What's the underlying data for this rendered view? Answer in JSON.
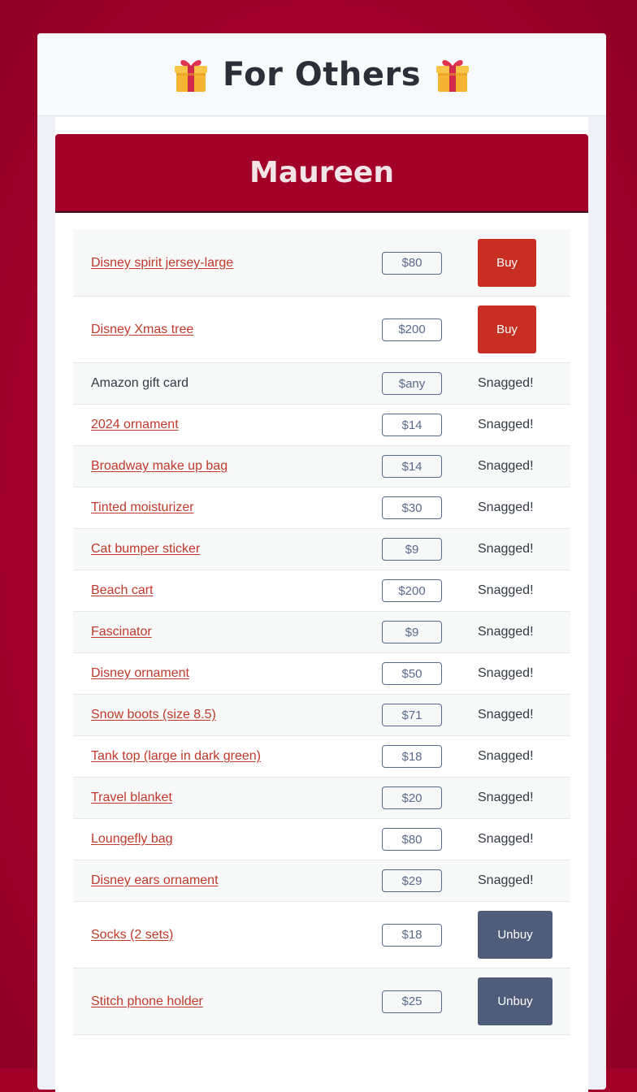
{
  "header": {
    "title": "For Others",
    "icon": "gift-icon"
  },
  "person": {
    "name": "Maureen"
  },
  "items": [
    {
      "name": "Disney spirit jersey-large",
      "linked": true,
      "price": "$80",
      "status": "buy",
      "action_label": "Buy"
    },
    {
      "name": "Disney Xmas tree",
      "linked": true,
      "price": "$200",
      "status": "buy",
      "action_label": "Buy"
    },
    {
      "name": "Amazon gift card",
      "linked": false,
      "price": "$any",
      "status": "snagged",
      "action_label": "Snagged!"
    },
    {
      "name": "2024 ornament",
      "linked": true,
      "price": "$14",
      "status": "snagged",
      "action_label": "Snagged!"
    },
    {
      "name": "Broadway make up bag",
      "linked": true,
      "price": "$14",
      "status": "snagged",
      "action_label": "Snagged!"
    },
    {
      "name": "Tinted moisturizer",
      "linked": true,
      "price": "$30",
      "status": "snagged",
      "action_label": "Snagged!"
    },
    {
      "name": "Cat bumper sticker",
      "linked": true,
      "price": "$9",
      "status": "snagged",
      "action_label": "Snagged!"
    },
    {
      "name": "Beach cart",
      "linked": true,
      "price": "$200",
      "status": "snagged",
      "action_label": "Snagged!"
    },
    {
      "name": "Fascinator",
      "linked": true,
      "price": "$9",
      "status": "snagged",
      "action_label": "Snagged!"
    },
    {
      "name": "Disney ornament",
      "linked": true,
      "price": "$50",
      "status": "snagged",
      "action_label": "Snagged!"
    },
    {
      "name": "Snow boots (size 8.5)",
      "linked": true,
      "price": "$71",
      "status": "snagged",
      "action_label": "Snagged!"
    },
    {
      "name": "Tank top (large in dark green)",
      "linked": true,
      "price": "$18",
      "status": "snagged",
      "action_label": "Snagged!"
    },
    {
      "name": "Travel blanket",
      "linked": true,
      "price": "$20",
      "status": "snagged",
      "action_label": "Snagged!"
    },
    {
      "name": "Loungefly bag",
      "linked": true,
      "price": "$80",
      "status": "snagged",
      "action_label": "Snagged!"
    },
    {
      "name": "Disney ears ornament",
      "linked": true,
      "price": "$29",
      "status": "snagged",
      "action_label": "Snagged!"
    },
    {
      "name": "Socks (2 sets)",
      "linked": true,
      "price": "$18",
      "status": "unbuy",
      "action_label": "Unbuy"
    },
    {
      "name": "Stitch phone holder",
      "linked": true,
      "price": "$25",
      "status": "unbuy",
      "action_label": "Unbuy"
    }
  ],
  "colors": {
    "background": "#a30029",
    "banner": "#a30029",
    "buy_button": "#c62f22",
    "unbuy_button": "#4f5c7a",
    "link": "#c0392b"
  }
}
